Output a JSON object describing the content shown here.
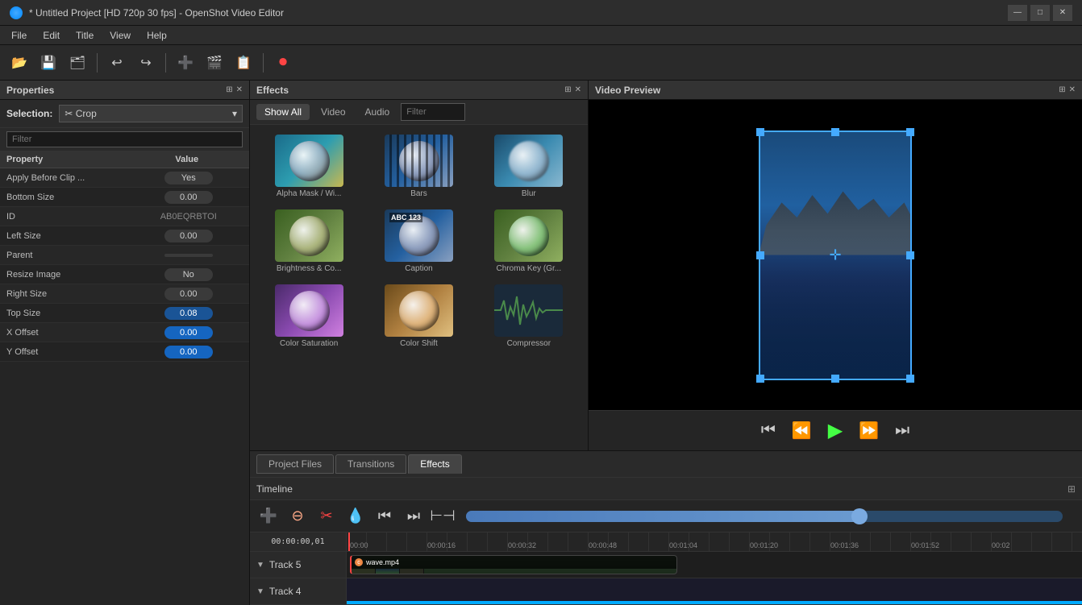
{
  "titlebar": {
    "title": "* Untitled Project [HD 720p 30 fps] - OpenShot Video Editor",
    "minimize_label": "—",
    "maximize_label": "□",
    "close_label": "✕"
  },
  "menubar": {
    "items": [
      {
        "label": "File"
      },
      {
        "label": "Edit"
      },
      {
        "label": "Title"
      },
      {
        "label": "View"
      },
      {
        "label": "Help"
      }
    ]
  },
  "toolbar": {
    "buttons": [
      "📁",
      "💾",
      "🗂",
      "↩",
      "↪",
      "➕",
      "🎬",
      "📋",
      "🔴"
    ]
  },
  "properties_panel": {
    "title": "Properties",
    "selection_label": "Selection:",
    "selection_value": "✂ Crop",
    "filter_placeholder": "Filter",
    "table_headers": {
      "property": "Property",
      "value": "Value"
    },
    "rows": [
      {
        "name": "Apply Before Clip ...",
        "value": "Yes",
        "type": "box"
      },
      {
        "name": "Bottom Size",
        "value": "0.00",
        "type": "box"
      },
      {
        "name": "ID",
        "value": "AB0EQRBTOI",
        "type": "text"
      },
      {
        "name": "Left Size",
        "value": "0.00",
        "type": "box"
      },
      {
        "name": "Parent",
        "value": "",
        "type": "box"
      },
      {
        "name": "Resize Image",
        "value": "No",
        "type": "box"
      },
      {
        "name": "Right Size",
        "value": "0.00",
        "type": "box"
      },
      {
        "name": "Top Size",
        "value": "0.08",
        "type": "box"
      },
      {
        "name": "X Offset",
        "value": "0.00",
        "type": "box-blue"
      },
      {
        "name": "Y Offset",
        "value": "0.00",
        "type": "box-blue"
      }
    ]
  },
  "effects_panel": {
    "title": "Effects",
    "tabs": [
      {
        "label": "Show All",
        "active": true
      },
      {
        "label": "Video",
        "active": false
      },
      {
        "label": "Audio",
        "active": false
      },
      {
        "label": "Filter",
        "active": false
      }
    ],
    "effects": [
      {
        "label": "Alpha Mask / Wi...",
        "thumb": "sphere-bg1"
      },
      {
        "label": "Bars",
        "thumb": "sphere-bg2"
      },
      {
        "label": "Blur",
        "thumb": "sphere-blur"
      },
      {
        "label": "Brightness & Co...",
        "thumb": "sphere-bg3"
      },
      {
        "label": "Caption",
        "thumb": "sphere-abc"
      },
      {
        "label": "Chroma Key (Gr...",
        "thumb": "sphere-bg4"
      },
      {
        "label": "Color Saturation",
        "thumb": "sphere-sat"
      },
      {
        "label": "Color Shift",
        "thumb": "sphere-shift"
      },
      {
        "label": "Compressor",
        "thumb": "sphere-wave"
      }
    ]
  },
  "video_preview": {
    "title": "Video Preview",
    "controls": {
      "rewind_end": "⏮",
      "rewind": "⏪",
      "play": "▶",
      "forward": "⏩",
      "forward_end": "⏭"
    }
  },
  "bottom_tabs": [
    {
      "label": "Project Files"
    },
    {
      "label": "Transitions"
    },
    {
      "label": "Effects",
      "active": true
    }
  ],
  "timeline": {
    "title": "Timeline",
    "current_time": "00:00:00,01",
    "ruler_marks": [
      "00:00",
      "00:00:16",
      "00:00:32",
      "00:00:48",
      "00:01:04",
      "00:01:20",
      "00:01:36",
      "00:01:52",
      "00:02"
    ],
    "toolbar_buttons": [
      {
        "icon": "➕",
        "color": "green"
      },
      {
        "icon": "⊖",
        "color": "red"
      },
      {
        "icon": "✂",
        "color": "red"
      },
      {
        "icon": "💧",
        "color": "orange"
      },
      {
        "icon": "⏮",
        "color": "normal"
      },
      {
        "icon": "⏭",
        "color": "normal"
      },
      {
        "icon": "⧗",
        "color": "normal"
      }
    ],
    "tracks": [
      {
        "name": "Track 5",
        "clips": [
          {
            "name": "wave.mp4",
            "icon_color": "#e84",
            "start_pct": 0,
            "width_pct": 45
          }
        ]
      },
      {
        "name": "Track 4",
        "clips": []
      }
    ]
  }
}
